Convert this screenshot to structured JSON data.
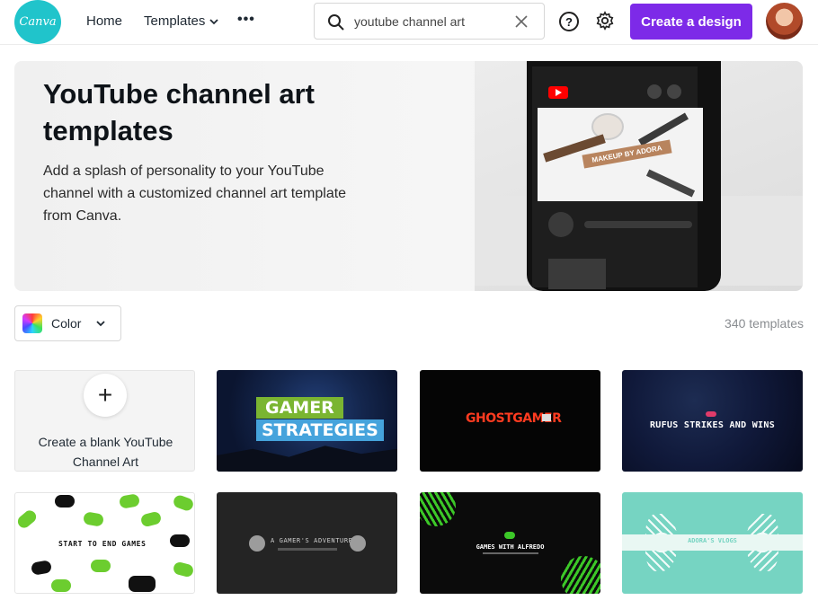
{
  "header": {
    "logo_text": "Canva",
    "nav": {
      "home_label": "Home",
      "templates_label": "Templates",
      "more_label": "•••"
    },
    "search": {
      "value": "youtube channel art",
      "placeholder": ""
    },
    "help_label": "?",
    "create_design_label": "Create a design",
    "brand_color": "#7d2ae8"
  },
  "hero": {
    "title": "YouTube channel art templates",
    "description": "Add a splash of personality to your YouTube channel with a customized channel art template from Canva.",
    "phone_banner_tag": "MAKEUP BY ADORA"
  },
  "filters": {
    "color_label": "Color",
    "template_count": "340 templates"
  },
  "templates": {
    "blank": {
      "plus_label": "+",
      "label": "Create a blank YouTube Channel Art"
    },
    "items": [
      {
        "line1": "GAMER",
        "line2": "STRATEGIES"
      },
      {
        "title": "GHOSTGAMER"
      },
      {
        "title": "RUFUS STRIKES AND WINS"
      },
      {
        "title": "START TO END GAMES"
      },
      {
        "title": "A GAMER'S ADVENTURES"
      },
      {
        "title": "GAMES WITH ALFREDO"
      },
      {
        "title": "ADORA'S VLOGS"
      }
    ]
  }
}
